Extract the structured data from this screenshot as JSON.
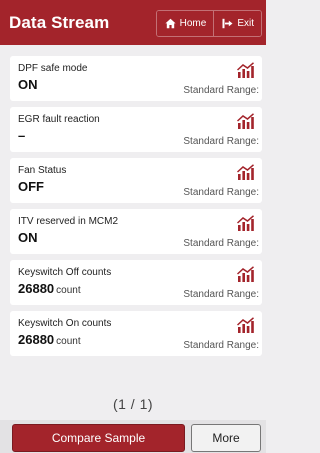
{
  "header": {
    "title": "Data Stream",
    "home_label": "Home",
    "exit_label": "Exit"
  },
  "items": [
    {
      "name": "DPF safe mode",
      "value": "ON",
      "unit": "",
      "range_label": "Standard Range:"
    },
    {
      "name": "EGR fault reaction",
      "value": "–",
      "unit": "",
      "range_label": "Standard Range:"
    },
    {
      "name": "Fan Status",
      "value": "OFF",
      "unit": "",
      "range_label": "Standard Range:"
    },
    {
      "name": "ITV reserved in MCM2",
      "value": "ON",
      "unit": "",
      "range_label": "Standard Range:"
    },
    {
      "name": "Keyswitch Off counts",
      "value": "26880",
      "unit": "count",
      "range_label": "Standard Range:"
    },
    {
      "name": "Keyswitch On counts",
      "value": "26880",
      "unit": "count",
      "range_label": "Standard Range:"
    }
  ],
  "pagination": "(1 / 1)",
  "footer": {
    "compare_label": "Compare Sample",
    "more_label": "More"
  },
  "colors": {
    "accent": "#a3242b",
    "background": "#efeef0"
  },
  "icons": [
    "home-icon",
    "exit-icon",
    "graph-icon"
  ]
}
